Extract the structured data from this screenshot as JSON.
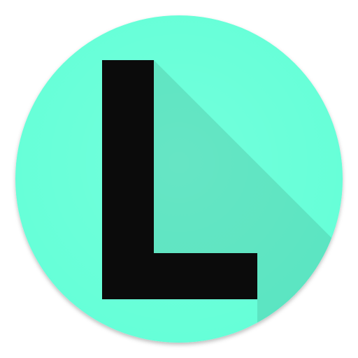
{
  "icon": {
    "name": "letter-l-app-icon",
    "glyph": "L",
    "colors": {
      "circle": "#66FFD8",
      "circle_edge_shadow": "#000000",
      "long_shadow": "#000000",
      "glyph": "#0B0B0B",
      "background": "#FFFFFF"
    }
  }
}
